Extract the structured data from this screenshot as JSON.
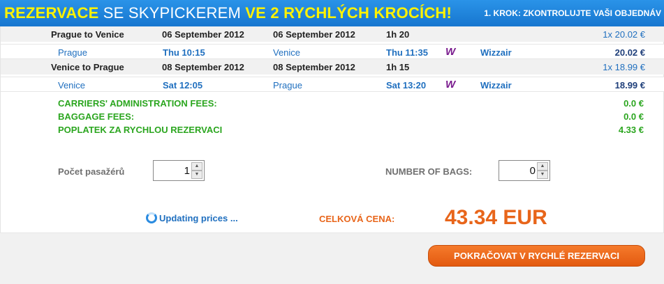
{
  "header": {
    "title_part1": "REZERVACE",
    "title_part2": " SE SKYPICKEREM ",
    "title_part3": "VE 2 RYCHLÝCH KROCÍCH!",
    "step": "1. KROK: ZKONTROLUJTE VAŠI OBJEDNÁV"
  },
  "flights": [
    {
      "route": "Prague to Venice",
      "date_depart": "06 September 2012",
      "date_arrive": "06 September 2012",
      "duration": "1h 20",
      "price": "1x 20.02 €",
      "leg": {
        "from": "Prague",
        "dep_time": "Thu 10:15",
        "to": "Venice",
        "arr_time": "Thu 11:35",
        "carrier_icon": "W",
        "carrier": "Wizzair",
        "price": "20.02 €"
      }
    },
    {
      "route": "Venice to Prague",
      "date_depart": "08 September 2012",
      "date_arrive": "08 September 2012",
      "duration": "1h 15",
      "price": "1x 18.99 €",
      "leg": {
        "from": "Venice",
        "dep_time": "Sat 12:05",
        "to": "Prague",
        "arr_time": "Sat 13:20",
        "carrier_icon": "W",
        "carrier": "Wizzair",
        "price": "18.99 €"
      }
    }
  ],
  "fees": [
    {
      "label": "CARRIERS' ADMINISTRATION FEES:",
      "value": "0.0 €"
    },
    {
      "label": "BAGGAGE FEES:",
      "value": "0.0 €"
    },
    {
      "label": "POPLATEK ZA RYCHLOU REZERVACI",
      "value": "4.33 €"
    }
  ],
  "passengers": {
    "label": "Počet pasažérů",
    "value": "1"
  },
  "bags": {
    "label": "NUMBER OF BAGS:",
    "value": "0"
  },
  "status": {
    "updating": "Updating prices ..."
  },
  "total": {
    "label": "CELKOVÁ CENA:",
    "value": "43.34 EUR"
  },
  "actions": {
    "continue": "POKRAČOVAT V RYCHLÉ REZERVACI"
  },
  "colors": {
    "header_blue": "#1e84dc",
    "highlight_yellow": "#fff200",
    "fee_green": "#2ba61f",
    "total_orange": "#e8651a",
    "link_blue": "#1f6fbf",
    "wizzair_purple": "#7a1c8e"
  }
}
